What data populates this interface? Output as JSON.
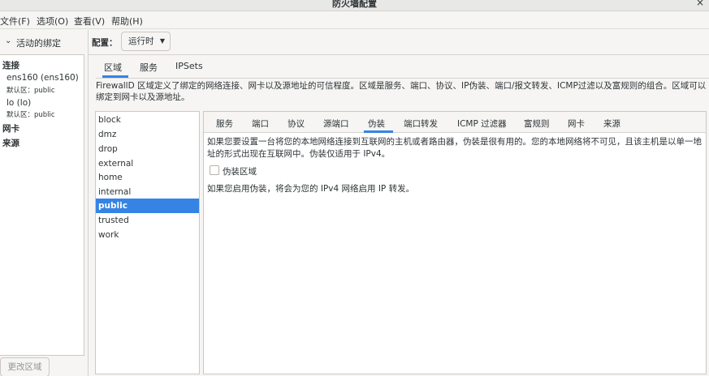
{
  "window": {
    "title": "防火墙配置",
    "close_glyph": "×"
  },
  "menubar": {
    "file": "文件(F)",
    "options": "选项(O)",
    "view": "查看(V)",
    "help": "帮助(H)"
  },
  "left": {
    "header_label": "活动的绑定",
    "chevron_glyph": "⌄",
    "connections_heading": "连接",
    "connections": [
      {
        "name": "ens160 (ens160)",
        "zone": "默认区：public"
      },
      {
        "name": "lo (lo)",
        "zone": "默认区：public"
      }
    ],
    "interfaces_heading": "网卡",
    "sources_heading": "来源",
    "change_zone_button": "更改区域"
  },
  "config": {
    "label": "配置：",
    "combo_value": "运行时",
    "combo_arrow": "▼"
  },
  "top_tabs": [
    {
      "label": "区域",
      "active": true
    },
    {
      "label": "服务",
      "active": false
    },
    {
      "label": "IPSets",
      "active": false
    }
  ],
  "description": "FirewallD 区域定义了绑定的网络连接、网卡以及源地址的可信程度。区域是服务、端口、协议、IP伪装、端口/报文转发、ICMP过滤以及富规则的组合。区域可以绑定到网卡以及源地址。",
  "zones": [
    "block",
    "dmz",
    "drop",
    "external",
    "home",
    "internal",
    "public",
    "trusted",
    "work"
  ],
  "selected_zone": "public",
  "sub_tabs": [
    "服务",
    "端口",
    "协议",
    "源端口",
    "伪装",
    "端口转发",
    "ICMP 过滤器",
    "富规则",
    "网卡",
    "来源"
  ],
  "active_sub_tab": "伪装",
  "masquerade": {
    "description": "如果您要设置一台将您的本地网络连接到互联网的主机或者路由器，伪装是很有用的。您的本地网络将不可见，且该主机是以单一地址的形式出现在互联网中。伪装仅适用于 IPv4。",
    "checkbox_label": "伪装区域",
    "checked": false,
    "note": "如果您启用伪装，将会为您的 IPv4 网络启用 IP 转发。"
  },
  "colors": {
    "accent": "#3584e4",
    "window_bg": "#f6f5f4",
    "panel_bg": "#ffffff",
    "border": "#cdc7c2",
    "text": "#2e3436"
  }
}
